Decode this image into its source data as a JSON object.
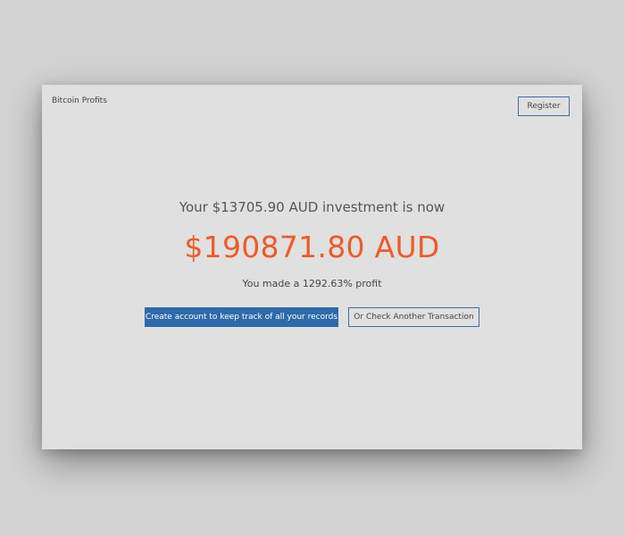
{
  "header": {
    "brand": "Bitcoin Profits",
    "register_label": "Register"
  },
  "result": {
    "headline": "Your $13705.90 AUD investment is now",
    "amount": "$190871.80 AUD",
    "profit_text": "You made a 1292.63% profit"
  },
  "actions": {
    "create_account_label": "Create account to keep track of all your records",
    "check_another_label": "Or Check Another Transaction"
  },
  "colors": {
    "accent_orange": "#f05a28",
    "primary_blue": "#2d6aa9",
    "panel_bg": "#e0e0e0"
  }
}
